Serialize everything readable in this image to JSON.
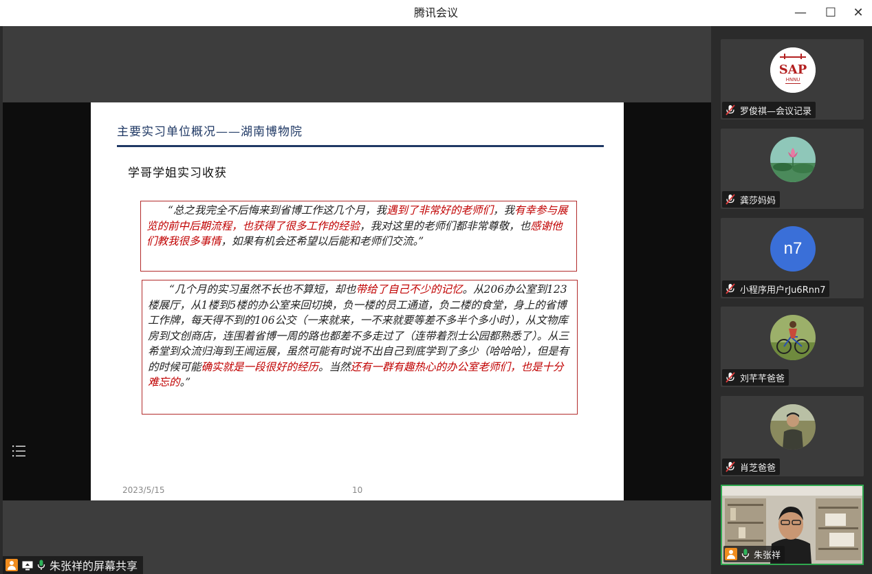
{
  "window": {
    "title": "腾讯会议",
    "minimize_label": "—",
    "maximize_label": "☐",
    "close_label": "✕"
  },
  "slide": {
    "heading": "主要实习单位概况——湖南博物院",
    "subheading": "学哥学姐实习收获",
    "quote1": [
      {
        "t": "“总之我完全不后悔来到省博工作这几个月，我",
        "red": false
      },
      {
        "t": "遇到了非常好的老师们",
        "red": true
      },
      {
        "t": "，我",
        "red": false
      },
      {
        "t": "有幸参与展览的前中后期流程，也获得了很多工作的经验",
        "red": true
      },
      {
        "t": "，我对这里的老师们都非常尊敬，也",
        "red": false
      },
      {
        "t": "感谢他们教我很多事情",
        "red": true
      },
      {
        "t": "，如果有机会还希望以后能和老师们交流。”",
        "red": false
      }
    ],
    "quote2": [
      {
        "t": "“几个月的实习虽然不长也不算短，却也",
        "red": false
      },
      {
        "t": "带给了自己不少的记忆",
        "red": true
      },
      {
        "t": "。从206办公室到123楼展厅，从1楼到5楼的办公室来回切换，负一楼的员工通道，负二楼的食堂，身上的省博工作牌，每天得不到的106公交（一来就来，一不来就要等差不多半个多小时），从文物库房到文创商店，连围着省博一周的路也都差不多走过了（连带着烈士公园都熟悉了）。从三希堂到众流归海到王闿运展，虽然可能有时说不出自己到底学到了多少（哈哈哈），但是有的时候可能",
        "red": false
      },
      {
        "t": "确实就是一段很好的经历",
        "red": true
      },
      {
        "t": "。当然",
        "red": false
      },
      {
        "t": "还有一群有趣热心的办公室老师们，也是十分难忘的",
        "red": true
      },
      {
        "t": "。”",
        "red": false
      }
    ],
    "date": "2023/5/15",
    "page": "10"
  },
  "share": {
    "label": "朱张祥的屏幕共享"
  },
  "participants": [
    {
      "name": "罗俊祺—会议记录",
      "avatar": "sap-logo",
      "logo_text": "SAP",
      "logo_sub": "HNNU",
      "muted": true
    },
    {
      "name": "龚莎妈妈",
      "avatar": "lotus-photo",
      "muted": true
    },
    {
      "name": "小程序用户rJu6Rnn7",
      "avatar": "initials",
      "initials": "n7",
      "color": "#3a6fd8",
      "muted": true
    },
    {
      "name": "刘芊芊爸爸",
      "avatar": "bicycle-photo",
      "muted": true
    },
    {
      "name": "肖芝爸爸",
      "avatar": "man-photo",
      "muted": true
    }
  ],
  "self_video": {
    "name": "朱张祥",
    "border_color": "#2fa84f"
  }
}
